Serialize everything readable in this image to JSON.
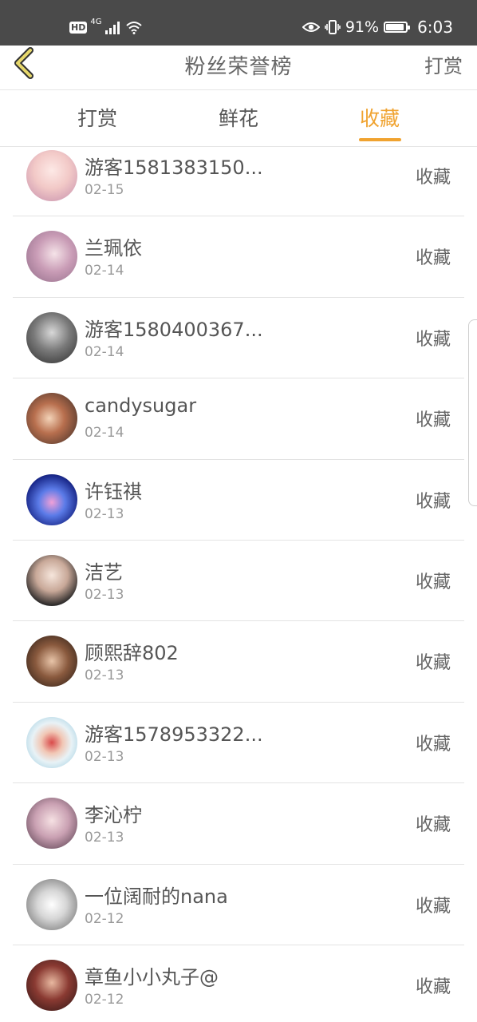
{
  "status_bar": {
    "hd": "HD",
    "network": "4G",
    "battery_text": "91%",
    "battery_level": 0.91,
    "time": "6:03",
    "icons": [
      "signal-icon",
      "wifi-icon",
      "eye-icon",
      "vibrate-icon",
      "battery-icon"
    ]
  },
  "header": {
    "back_icon": "chevron-left-icon",
    "title": "粉丝荣誉榜",
    "action": "打赏"
  },
  "tabs": [
    {
      "label": "打赏",
      "active": false
    },
    {
      "label": "鲜花",
      "active": false
    },
    {
      "label": "收藏",
      "active": true
    }
  ],
  "colors": {
    "accent": "#f0a330",
    "back_icon": "#e7d86b",
    "status_bar_bg": "#4a4a4a"
  },
  "items": [
    {
      "name": "游客1581383150...",
      "date": "02-15",
      "action": "收藏"
    },
    {
      "name": "兰珮依",
      "date": "02-14",
      "action": "收藏"
    },
    {
      "name": "游客1580400367...",
      "date": "02-14",
      "action": "收藏"
    },
    {
      "name": "candysugar",
      "date": "02-14",
      "action": "收藏"
    },
    {
      "name": "许钰祺",
      "date": "02-13",
      "action": "收藏"
    },
    {
      "name": "洁艺",
      "date": "02-13",
      "action": "收藏"
    },
    {
      "name": "顾熙辞802",
      "date": "02-13",
      "action": "收藏"
    },
    {
      "name": "游客1578953322...",
      "date": "02-13",
      "action": "收藏"
    },
    {
      "name": "李沁柠",
      "date": "02-13",
      "action": "收藏"
    },
    {
      "name": "一位阔耐的nana",
      "date": "02-12",
      "action": "收藏"
    },
    {
      "name": "章鱼小小丸子@",
      "date": "02-12",
      "action": "收藏"
    }
  ]
}
